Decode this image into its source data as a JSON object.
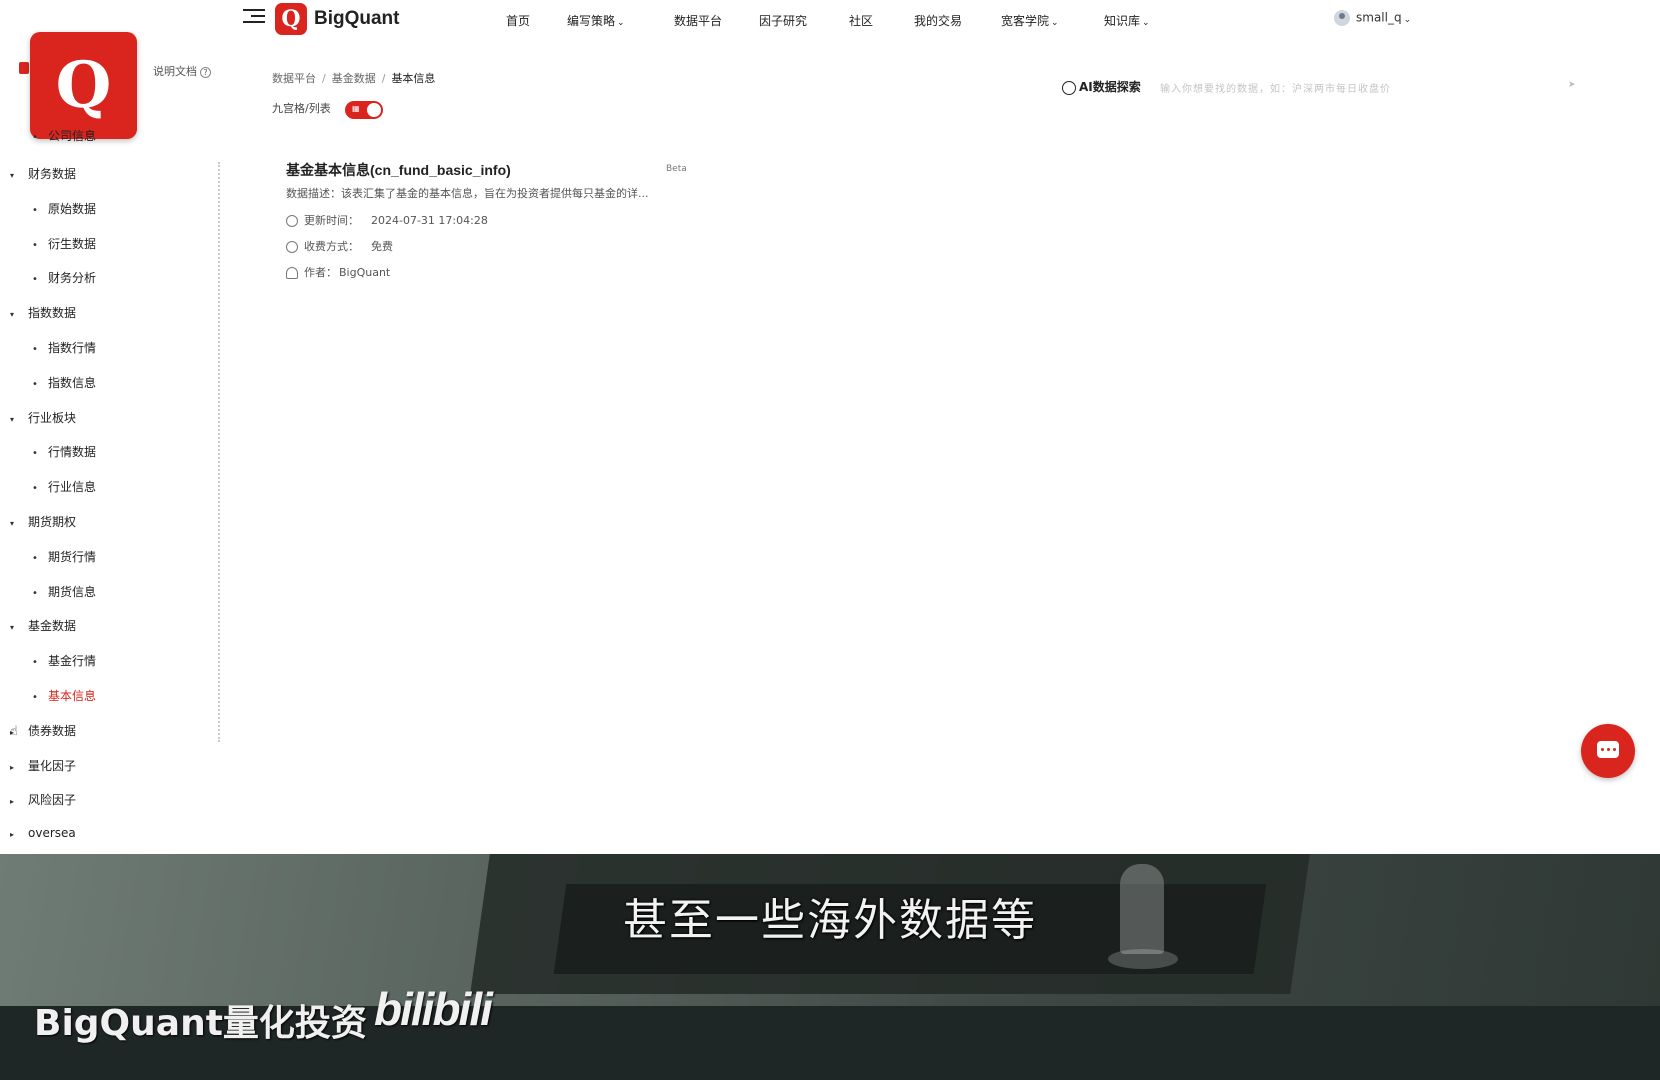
{
  "header": {
    "brand": "BigQuant",
    "brand_logo_letter": "Q",
    "nav": [
      {
        "label": "首页",
        "dropdown": false
      },
      {
        "label": "编写策略",
        "dropdown": true
      },
      {
        "label": "数据平台",
        "dropdown": false
      },
      {
        "label": "因子研究",
        "dropdown": false
      },
      {
        "label": "社区",
        "dropdown": false
      },
      {
        "label": "我的交易",
        "dropdown": false
      },
      {
        "label": "宽客学院",
        "dropdown": true
      },
      {
        "label": "知识库",
        "dropdown": true
      }
    ],
    "user": "small_q"
  },
  "sidebar": {
    "doc_link": "说明文档",
    "partial_item": "公司信息",
    "items": [
      {
        "type": "cat",
        "label": "财务数据",
        "expanded": true
      },
      {
        "type": "sub",
        "label": "原始数据"
      },
      {
        "type": "sub",
        "label": "衍生数据"
      },
      {
        "type": "sub",
        "label": "财务分析"
      },
      {
        "type": "cat",
        "label": "指数数据",
        "expanded": true
      },
      {
        "type": "sub",
        "label": "指数行情"
      },
      {
        "type": "sub",
        "label": "指数信息"
      },
      {
        "type": "cat",
        "label": "行业板块",
        "expanded": true
      },
      {
        "type": "sub",
        "label": "行情数据"
      },
      {
        "type": "sub",
        "label": "行业信息"
      },
      {
        "type": "cat",
        "label": "期货期权",
        "expanded": true
      },
      {
        "type": "sub",
        "label": "期货行情"
      },
      {
        "type": "sub",
        "label": "期货信息"
      },
      {
        "type": "cat",
        "label": "基金数据",
        "expanded": true
      },
      {
        "type": "sub",
        "label": "基金行情"
      },
      {
        "type": "sub",
        "label": "基本信息",
        "active": true
      },
      {
        "type": "cat",
        "label": "债券数据",
        "expanded": false
      },
      {
        "type": "cat",
        "label": "量化因子",
        "expanded": false
      },
      {
        "type": "cat",
        "label": "风险因子",
        "expanded": false
      },
      {
        "type": "cat",
        "label": "oversea",
        "expanded": false
      }
    ]
  },
  "main": {
    "breadcrumb": [
      "数据平台",
      "基金数据",
      "基本信息"
    ],
    "view_toggle_label": "九宫格/列表",
    "ai_label": "AI数据探索",
    "ai_placeholder": "输入你想要找的数据，如：沪深两市每日收盘价",
    "card": {
      "title": "基金基本信息(cn_fund_basic_info)",
      "badge": "Beta",
      "desc": "数据描述：该表汇集了基金的基本信息，旨在为投资者提供每只基金的详...",
      "updated_label": "更新时间：",
      "updated_value": "2024-07-31 17:04:28",
      "fee_label": "收费方式：",
      "fee_value": "免费",
      "author_label": "作者：",
      "author_value": "BigQuant"
    }
  },
  "video": {
    "subtitle": "甚至一些海外数据等",
    "watermark": "BigQuant量化投资",
    "platform": "bilibili"
  },
  "colors": {
    "accent": "#d9251d"
  }
}
